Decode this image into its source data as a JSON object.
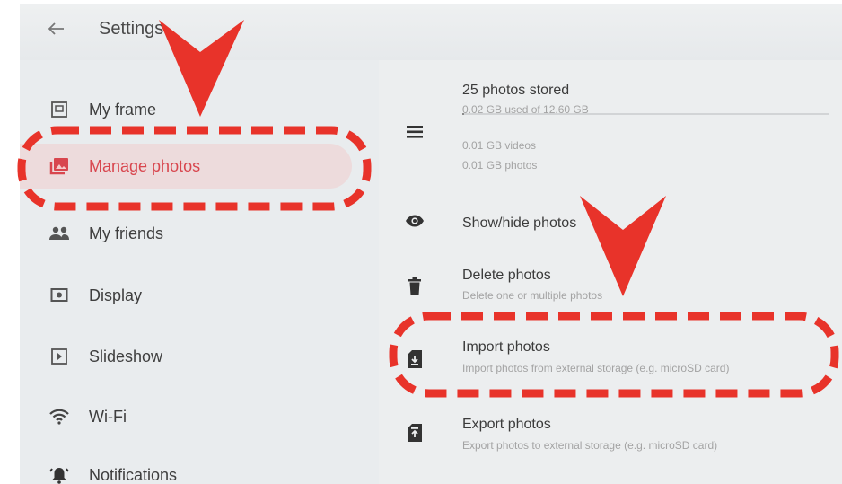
{
  "header": {
    "title": "Settings"
  },
  "sidebar": {
    "items": [
      {
        "label": "My frame"
      },
      {
        "label": "Manage photos",
        "active": true
      },
      {
        "label": "My friends"
      },
      {
        "label": "Display"
      },
      {
        "label": "Slideshow"
      },
      {
        "label": "Wi-Fi"
      },
      {
        "label": "Notifications"
      }
    ]
  },
  "storage": {
    "title": "25 photos stored",
    "used": "0.02 GB used of 12.60 GB",
    "used_fraction": 0.0016,
    "videos": "0.01 GB videos",
    "photos": "0.01 GB photos"
  },
  "options": [
    {
      "label": "Show/hide photos",
      "desc": ""
    },
    {
      "label": "Delete photos",
      "desc": "Delete one or multiple photos"
    },
    {
      "label": "Import photos",
      "desc": "Import photos from external storage (e.g. microSD card)"
    },
    {
      "label": "Export photos",
      "desc": "Export photos to external storage (e.g. microSD card)"
    }
  ],
  "colors": {
    "accent": "#d8464e",
    "annotation": "#e8332a"
  }
}
